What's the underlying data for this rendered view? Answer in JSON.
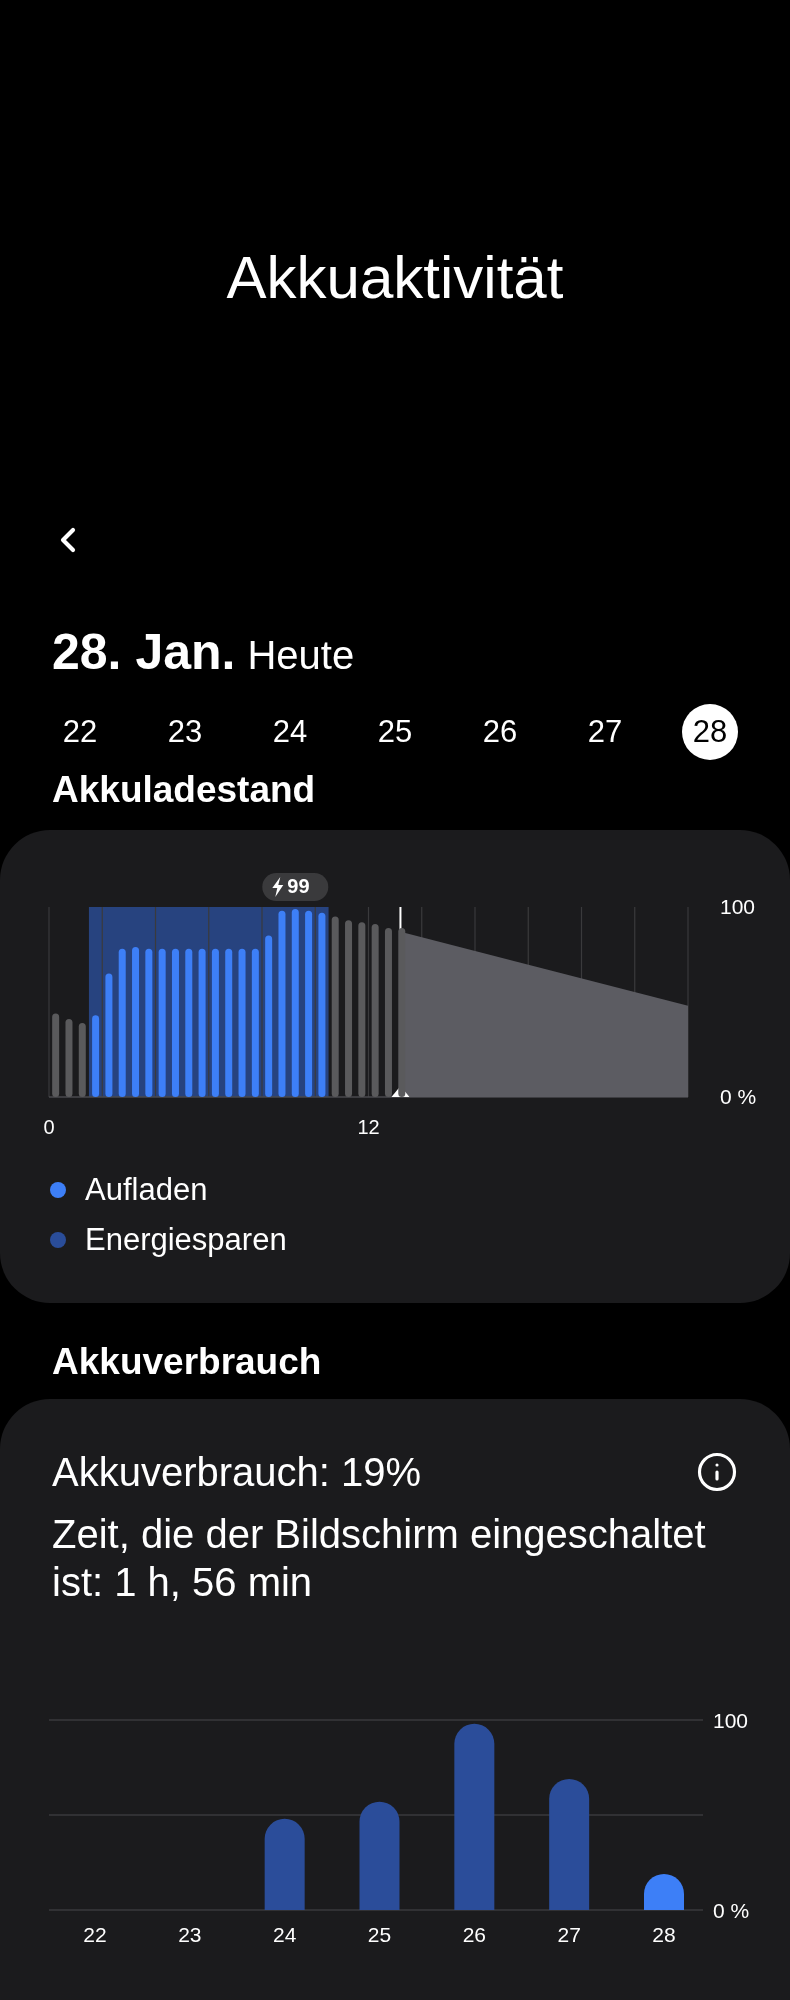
{
  "title": "Akkuaktivität",
  "date": {
    "day": "28. Jan.",
    "relative": "Heute"
  },
  "dates": [
    {
      "label": "22",
      "selected": false
    },
    {
      "label": "23",
      "selected": false
    },
    {
      "label": "24",
      "selected": false
    },
    {
      "label": "25",
      "selected": false
    },
    {
      "label": "26",
      "selected": false
    },
    {
      "label": "27",
      "selected": false
    },
    {
      "label": "28",
      "selected": true
    }
  ],
  "charge_section": {
    "heading": "Akkuladestand",
    "chart_data": {
      "type": "bar",
      "xlim": [
        0,
        24
      ],
      "ylim": [
        0,
        100
      ],
      "xticks": [
        0,
        12
      ],
      "yticks": [
        {
          "value": 0,
          "label": "0 %"
        },
        {
          "value": 100,
          "label": "100"
        }
      ],
      "x": [
        0.25,
        0.75,
        1.25,
        1.75,
        2.25,
        2.75,
        3.25,
        3.75,
        4.25,
        4.75,
        5.25,
        5.75,
        6.25,
        6.75,
        7.25,
        7.75,
        8.25,
        8.75,
        9.25,
        9.75,
        10.25,
        10.75,
        11.25,
        11.75,
        12.25,
        12.75,
        13.25
      ],
      "series": [
        {
          "color": "#5a5a5c",
          "values": [
            44,
            41,
            39,
            null,
            null,
            null,
            null,
            null,
            null,
            null,
            null,
            null,
            null,
            null,
            null,
            null,
            null,
            null,
            null,
            null,
            null,
            95,
            93,
            92,
            91,
            89,
            89
          ]
        },
        {
          "color": "#3d7ff7",
          "values": [
            null,
            null,
            null,
            43,
            65,
            78,
            79,
            78,
            78,
            78,
            78,
            78,
            78,
            78,
            78,
            78,
            85,
            98,
            99,
            98,
            97,
            null,
            null,
            null,
            null,
            null,
            null
          ]
        }
      ],
      "bands": [
        {
          "axis": "x",
          "from": 1.5,
          "to": 10.5,
          "color": "#2a4d99"
        }
      ],
      "ref_lines": [
        {
          "axis": "x",
          "value": 13.2
        }
      ],
      "annotations": [
        "99"
      ]
    },
    "legend": [
      {
        "label": "Aufladen",
        "color": "#3d7ff7"
      },
      {
        "label": "Energiesparen",
        "color": "#2a4d99"
      }
    ]
  },
  "usage_section": {
    "heading": "Akkuverbrauch",
    "usage": "Akkuverbrauch: 19%",
    "screen_time": "Zeit, die der Bildschirm eingeschaltet ist: 1 h, 56 min",
    "chart_data": {
      "type": "bar",
      "categories": [
        "22",
        "23",
        "24",
        "25",
        "26",
        "27",
        "28"
      ],
      "ylim": [
        0,
        100
      ],
      "yticks": [
        {
          "value": 0,
          "label": "0 %"
        },
        {
          "value": 100,
          "label": "100"
        }
      ],
      "ref_lines": [
        {
          "axis": "y",
          "value": 50
        }
      ],
      "series": [
        {
          "color": "#2b4d9a",
          "values": [
            null,
            null,
            48,
            57,
            98,
            69,
            null
          ]
        },
        {
          "color": "#3d7ff7",
          "values": [
            null,
            null,
            null,
            null,
            null,
            null,
            19
          ]
        }
      ]
    }
  }
}
